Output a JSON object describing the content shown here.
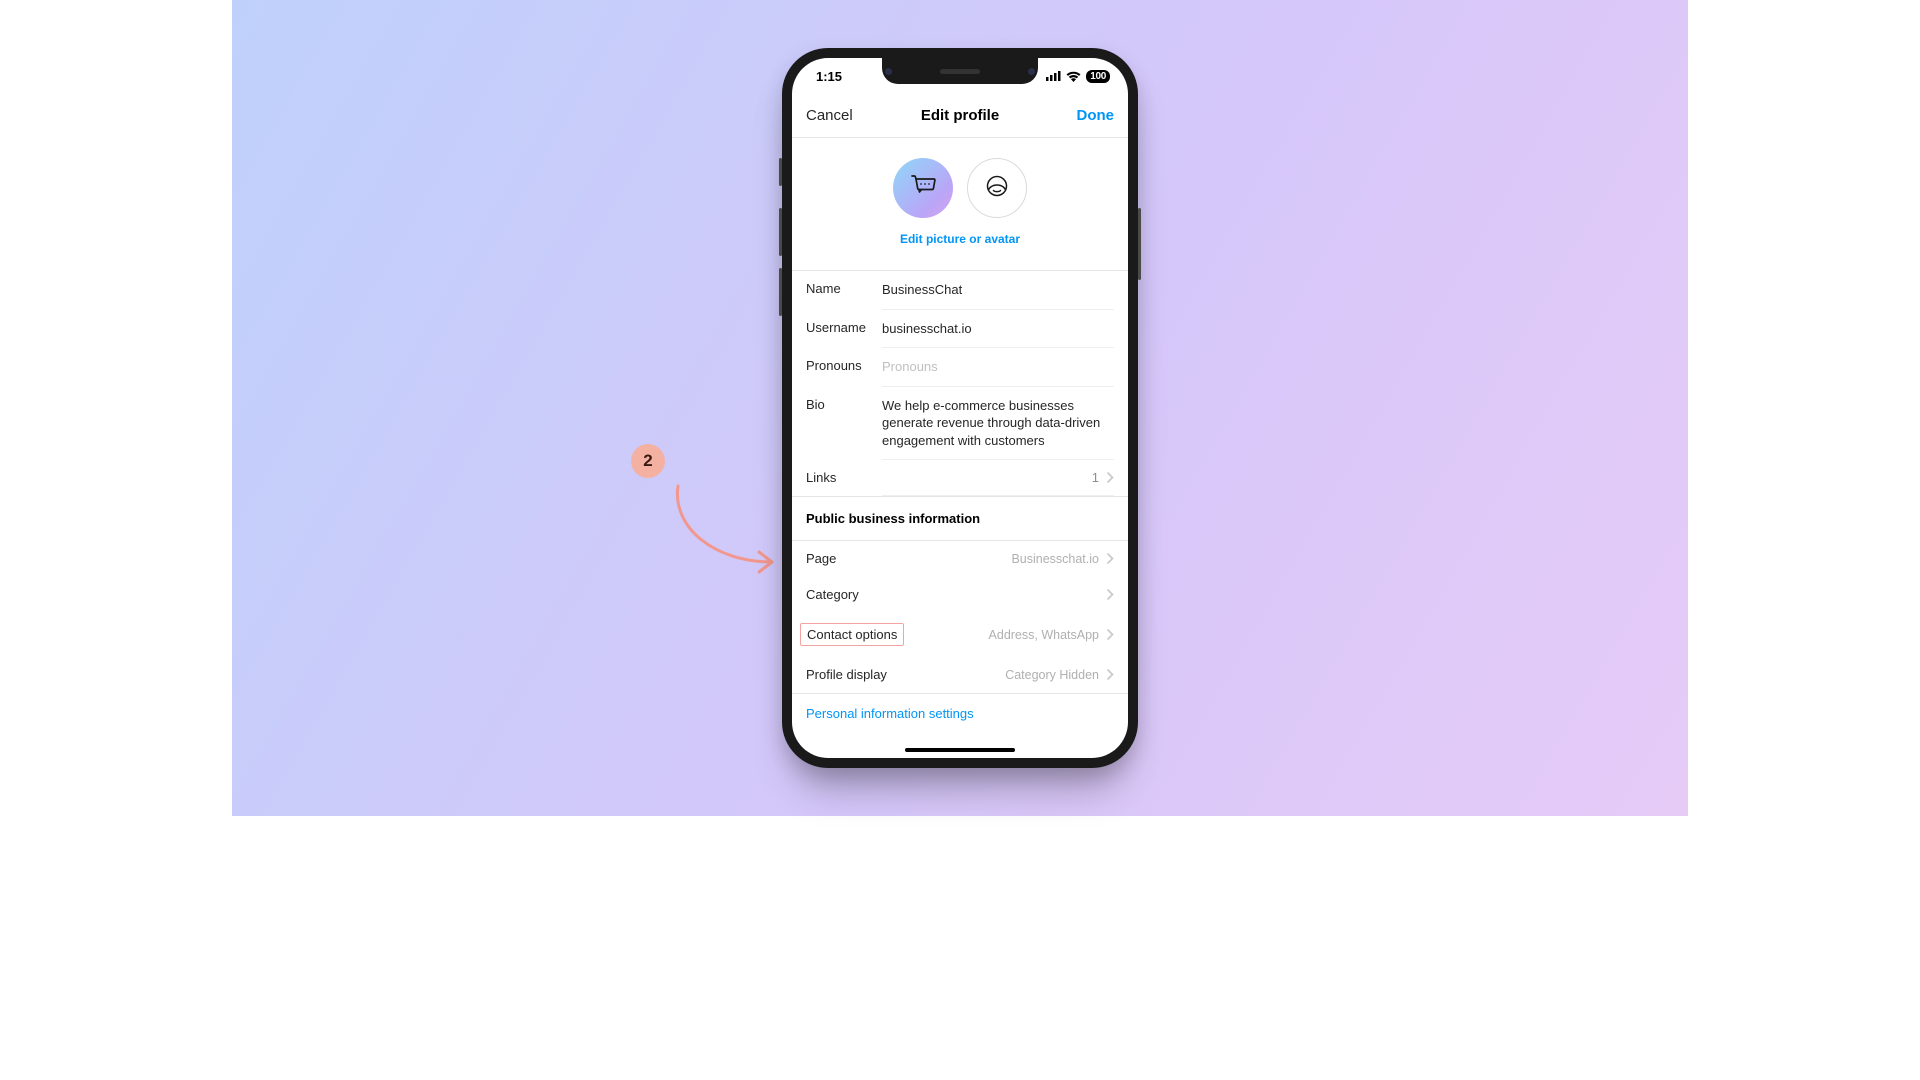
{
  "annotation": {
    "step": "2"
  },
  "status": {
    "time": "1:15",
    "battery": "100"
  },
  "nav": {
    "cancel": "Cancel",
    "title": "Edit profile",
    "done": "Done"
  },
  "avatar": {
    "edit_link": "Edit picture or avatar"
  },
  "fields": {
    "name_label": "Name",
    "name_value": "BusinessChat",
    "username_label": "Username",
    "username_value": "businesschat.io",
    "pronouns_label": "Pronouns",
    "pronouns_placeholder": "Pronouns",
    "bio_label": "Bio",
    "bio_value": "We help e-commerce businesses generate revenue through data-driven engagement with customers",
    "links_label": "Links",
    "links_count": "1"
  },
  "section_header": "Public business information",
  "business": {
    "page_label": "Page",
    "page_value": "Businesschat.io",
    "category_label": "Category",
    "category_value": "",
    "contact_label": "Contact options",
    "contact_value": "Address, WhatsApp",
    "display_label": "Profile display",
    "display_value": "Category Hidden"
  },
  "personal_link": "Personal information settings"
}
